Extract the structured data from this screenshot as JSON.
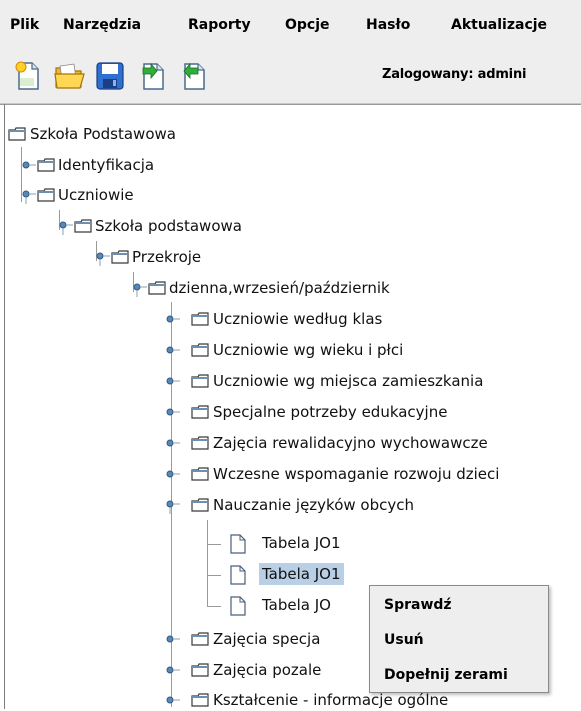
{
  "menubar": {
    "items": [
      "Plik",
      "Narzędzia",
      "Raporty",
      "Opcje",
      "Hasło",
      "Aktualizacje"
    ]
  },
  "toolbar": {
    "login_text": "Zalogowany: admini",
    "buttons": [
      "new-document-icon",
      "open-folder-icon",
      "save-icon",
      "import-document-icon",
      "export-document-icon"
    ]
  },
  "tree": {
    "root": "Szkoła Podstawowa",
    "identyfikacja": "Identyfikacja",
    "uczniowie": "Uczniowie",
    "szkola_podstawowa": "Szkoła podstawowa",
    "przekroje": "Przekroje",
    "dzienna": "dzienna,wrzesień/październik",
    "children": [
      "Uczniowie według klas",
      "Uczniowie wg wieku i płci",
      "Uczniowie wg miejsca zamieszkania",
      "Specjalne potrzeby edukacyjne",
      "Zajęcia rewalidacyjno wychowawcze",
      "Wczesne wspomaganie rozwoju dzieci",
      "Nauczanie języków obcych"
    ],
    "tables": [
      "Tabela JO1",
      "Tabela JO1",
      "Tabela JO"
    ],
    "after": [
      "Zajęcia specja",
      "Zajęcia pozale",
      "Kształcenie - informacje ogólne"
    ]
  },
  "context_menu": {
    "items": [
      "Sprawdź",
      "Usuń",
      "Dopełnij zerami"
    ]
  },
  "colors": {
    "selection": "#b8cfe5",
    "folder_outline": "#3a3a3a",
    "background": "#eeeeee"
  }
}
